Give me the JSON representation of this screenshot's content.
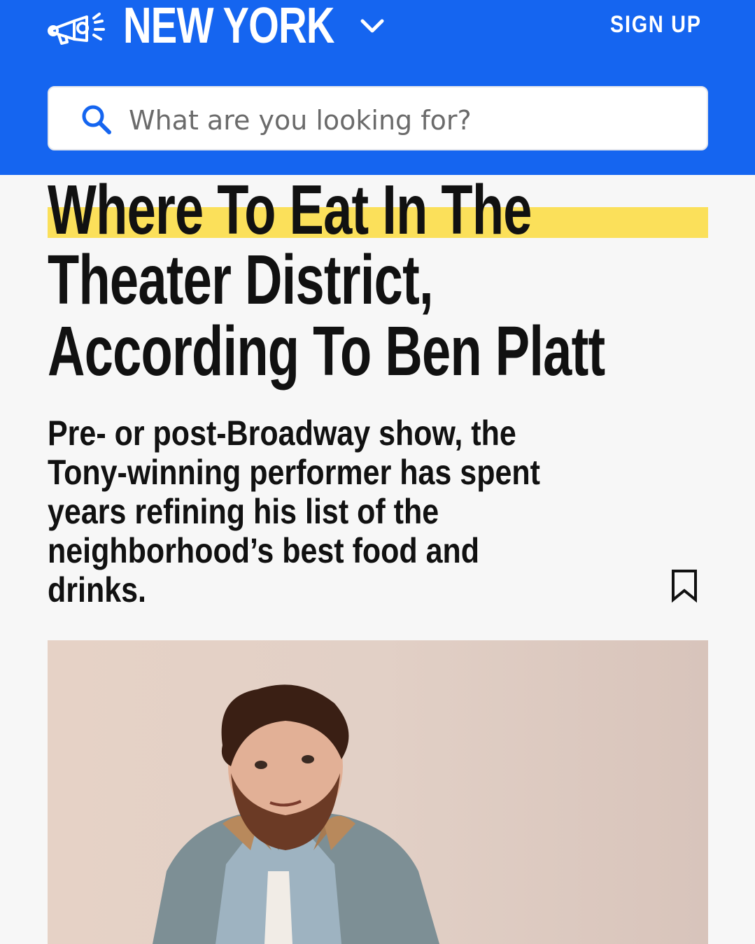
{
  "header": {
    "city": "NEW YORK",
    "signup_label": "SIGN UP",
    "background_color": "#1565f0"
  },
  "search": {
    "placeholder": "What are you looking for?"
  },
  "article": {
    "title_lines": [
      "Where To Eat In The",
      "Theater District,",
      "According To Ben Platt"
    ],
    "dek_lines": [
      "Pre- or post-Broadway show, the",
      "Tony-winning performer has spent",
      "years refining his list of the",
      "neighborhood’s best food and",
      "drinks."
    ],
    "highlight_color": "#fbe05a"
  },
  "icons": {
    "logo": "megaphone-icon",
    "city_menu": "chevron-down-icon",
    "search": "search-icon",
    "save": "bookmark-icon"
  }
}
